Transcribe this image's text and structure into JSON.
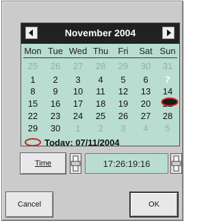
{
  "calendar": {
    "month_label": "November 2004",
    "weekdays": [
      "Mon",
      "Tue",
      "Wed",
      "Thu",
      "Fri",
      "Sat",
      "Sun"
    ],
    "weeks": [
      [
        "25",
        "26",
        "27",
        "28",
        "29",
        "30",
        "31"
      ],
      [
        "1",
        "2",
        "3",
        "4",
        "5",
        "6",
        "7"
      ],
      [
        "8",
        "9",
        "10",
        "11",
        "12",
        "13",
        "14"
      ],
      [
        "15",
        "16",
        "17",
        "18",
        "19",
        "20",
        "21"
      ],
      [
        "22",
        "23",
        "24",
        "25",
        "26",
        "27",
        "28"
      ],
      [
        "29",
        "30",
        "1",
        "2",
        "3",
        "4",
        "5"
      ]
    ],
    "today_text": "Today: 07/11/2004",
    "today_highlight_color": "#d62020",
    "selected_fill_color": "#1a1a1a"
  },
  "time": {
    "button_label": "Time",
    "value": "17:26:19:16"
  },
  "buttons": {
    "cancel_label": "Cancel",
    "ok_label": "OK"
  },
  "colors": {
    "calendar_bg": "#b9ddd1",
    "header_bg": "#212121",
    "dialog_bg": "#cbcbcb"
  }
}
